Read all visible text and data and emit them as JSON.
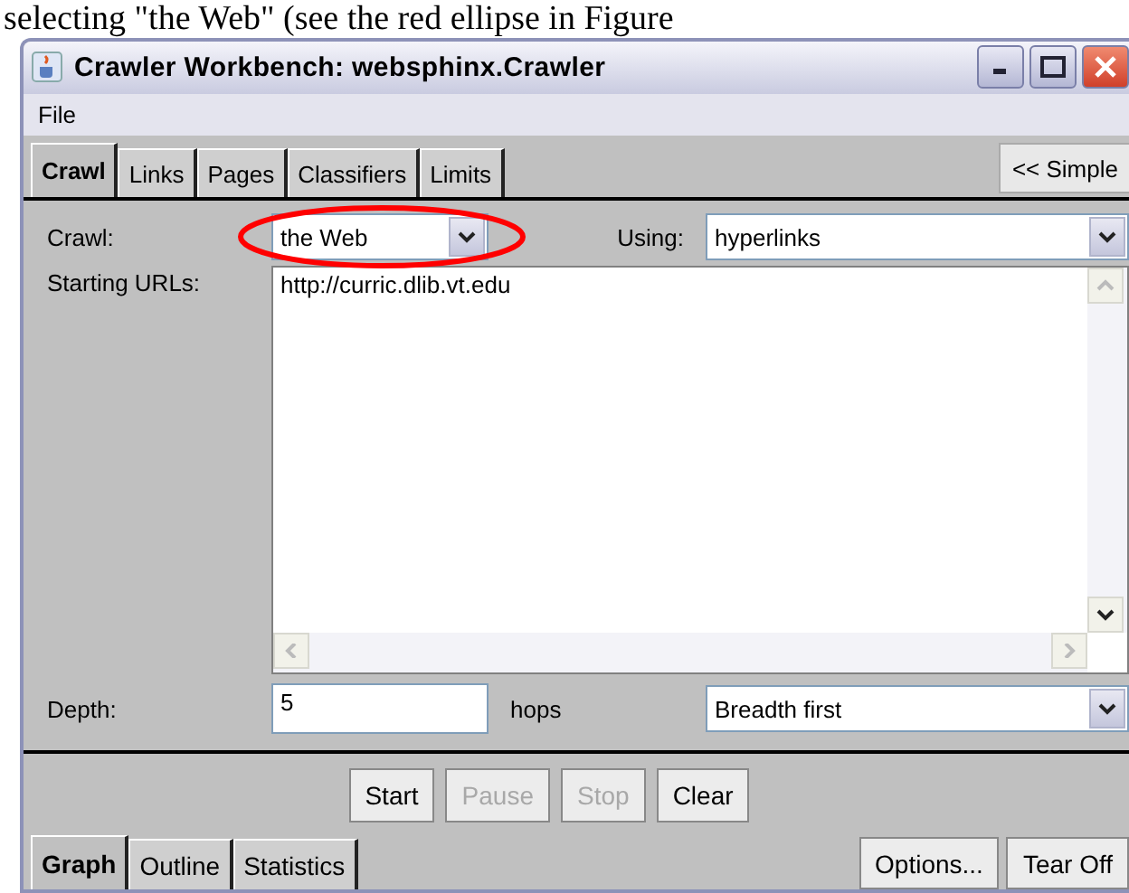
{
  "caption": "selecting \"the Web\" (see the red ellipse in Figure",
  "window": {
    "title": "Crawler Workbench: websphinx.Crawler"
  },
  "menu": [
    "File"
  ],
  "tabs": [
    {
      "label": "Crawl",
      "selected": true
    },
    {
      "label": "Links",
      "selected": false
    },
    {
      "label": "Pages",
      "selected": false
    },
    {
      "label": "Classifiers",
      "selected": false
    },
    {
      "label": "Limits",
      "selected": false
    }
  ],
  "mode_button": "<< Simple",
  "form": {
    "crawl_label": "Crawl:",
    "crawl_value": "the Web",
    "using_label": "Using:",
    "using_value": "hyperlinks",
    "urls_label": "Starting URLs:",
    "urls_value": "http://curric.dlib.vt.edu",
    "depth_label": "Depth:",
    "depth_value": "5",
    "hops_label": "hops",
    "order_value": "Breadth first"
  },
  "actions": [
    {
      "label": "Start",
      "disabled": false
    },
    {
      "label": "Pause",
      "disabled": true
    },
    {
      "label": "Stop",
      "disabled": true
    },
    {
      "label": "Clear",
      "disabled": false
    }
  ],
  "view_tabs": [
    {
      "label": "Graph",
      "selected": true
    },
    {
      "label": "Outline",
      "selected": false
    },
    {
      "label": "Statistics",
      "selected": false
    }
  ],
  "side_buttons": [
    "Options...",
    "Tear Off"
  ],
  "annotation": {
    "kind": "ellipse"
  }
}
